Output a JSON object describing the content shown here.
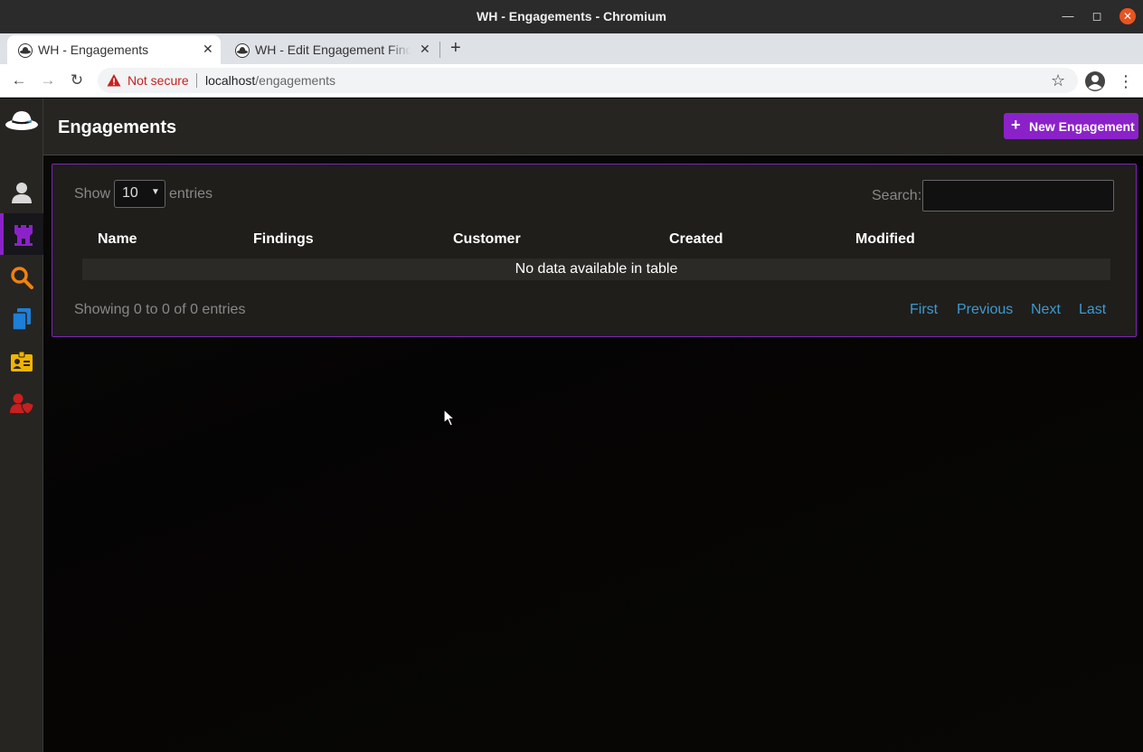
{
  "window": {
    "title": "WH - Engagements - Chromium"
  },
  "tabs": [
    {
      "label": "WH - Engagements"
    },
    {
      "label": "WH - Edit Engagement Findings"
    }
  ],
  "addressbar": {
    "security": "Not secure",
    "host": "localhost",
    "path": "/engagements"
  },
  "header": {
    "title": "Engagements",
    "new_button": "New Engagement"
  },
  "table": {
    "show_label": "Show",
    "page_size": "10",
    "entries_label": "entries",
    "search_label": "Search:",
    "search_value": "",
    "columns": [
      "Name",
      "Findings",
      "Customer",
      "Created",
      "Modified"
    ],
    "empty_message": "No data available in table",
    "info": "Showing 0 to 0 of 0 entries",
    "pagination": {
      "first": "First",
      "previous": "Previous",
      "next": "Next",
      "last": "Last"
    }
  },
  "colors": {
    "accent": "#8b22c9",
    "link": "#3d9ad1",
    "warning": "#c5221f",
    "search_icon": "#f0820f",
    "files_icon": "#1d7fd6",
    "badge_icon": "#f0b400",
    "user_shield_icon": "#c81f1f"
  },
  "sidebar": {
    "items": [
      {
        "icon": "user-icon"
      },
      {
        "icon": "castle-icon",
        "active": true
      },
      {
        "icon": "search-icon"
      },
      {
        "icon": "files-icon"
      },
      {
        "icon": "id-badge-icon"
      },
      {
        "icon": "user-shield-icon"
      }
    ]
  }
}
